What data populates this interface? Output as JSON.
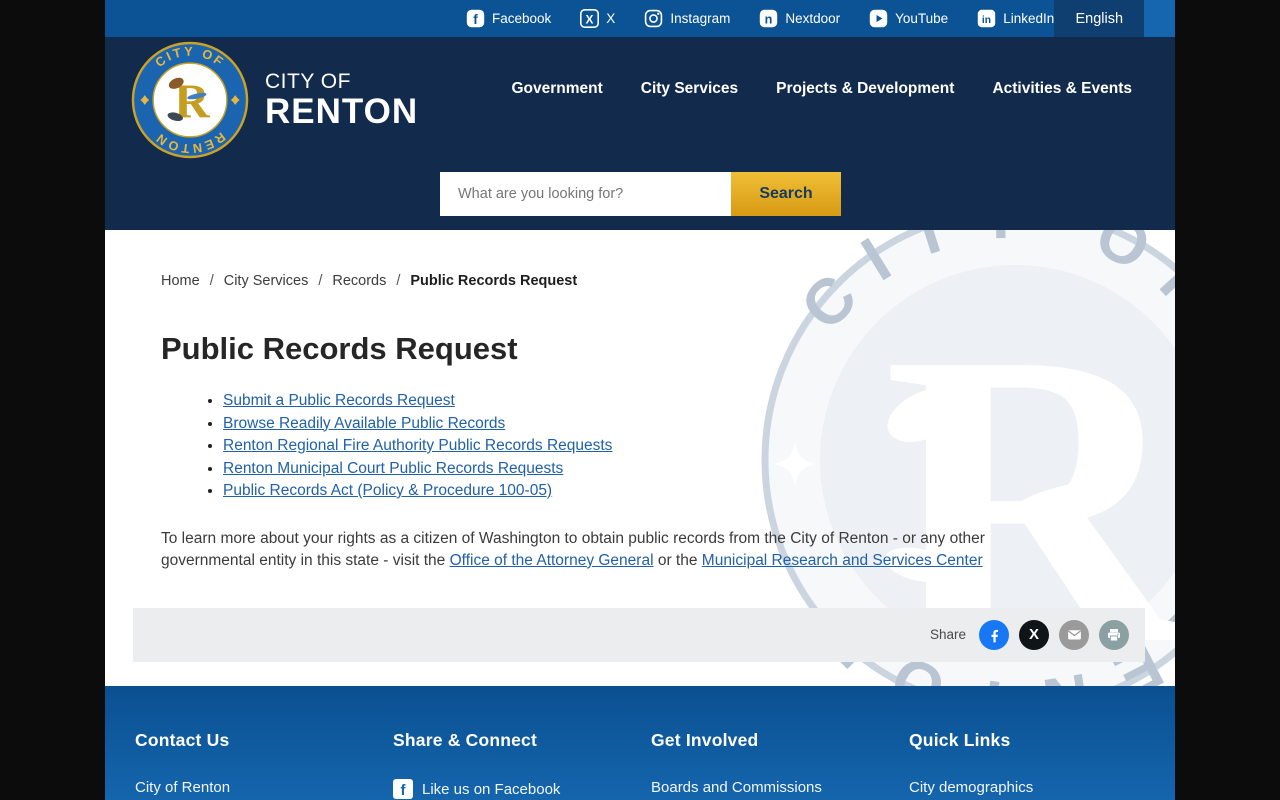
{
  "top_bar": {
    "social_links": [
      {
        "label": "Facebook",
        "icon": "facebook-icon"
      },
      {
        "label": "X",
        "icon": "x-icon"
      },
      {
        "label": "Instagram",
        "icon": "instagram-icon"
      },
      {
        "label": "Nextdoor",
        "icon": "nextdoor-icon"
      },
      {
        "label": "YouTube",
        "icon": "youtube-icon"
      },
      {
        "label": "LinkedIn",
        "icon": "linkedin-icon"
      }
    ],
    "language": "English"
  },
  "header": {
    "logo": {
      "line1": "CITY OF",
      "line2": "RENTON",
      "seal_top": "CITY OF",
      "seal_bottom": "RENTON"
    },
    "nav": [
      {
        "label": "Government"
      },
      {
        "label": "City Services"
      },
      {
        "label": "Projects & Development"
      },
      {
        "label": "Activities & Events"
      }
    ],
    "search": {
      "placeholder": "What are you looking for?",
      "button": "Search"
    }
  },
  "breadcrumb": [
    "Home",
    "City Services",
    "Records",
    "Public Records Request"
  ],
  "page": {
    "title": "Public Records Request",
    "links": [
      "Submit a Public Records Request",
      "Browse Readily Available Public Records",
      "Renton Regional Fire Authority Public Records Requests",
      "Renton Municipal Court Public Records Requests",
      "Public Records Act (Policy & Procedure 100-05)"
    ],
    "paragraph": {
      "before": "To learn more about your rights as a citizen of Washington to obtain public records from the City of Renton - or any other governmental entity in this state - visit the ",
      "link1": "Office of the Attorney General",
      "middle": " or the ",
      "link2": "Municipal Research and Services Center"
    },
    "share_label": "Share"
  },
  "watermark": {
    "top_text": "CITY OF",
    "bottom_text": "RENTON",
    "monogram": "R"
  },
  "icons": {
    "facebook_glyph": "f",
    "x_glyph": "X",
    "nextdoor_glyph": "n",
    "linkedin_glyph": "in"
  },
  "footer": {
    "columns": [
      {
        "heading": "Contact Us",
        "items": [
          "City of Renton"
        ]
      },
      {
        "heading": "Share & Connect",
        "items": [
          "Like us on Facebook"
        ]
      },
      {
        "heading": "Get Involved",
        "items": [
          "Boards and Commissions"
        ]
      },
      {
        "heading": "Quick Links",
        "items": [
          "City demographics"
        ]
      }
    ]
  },
  "colors": {
    "topbar_blue": "#0b5394",
    "header_navy": "#122a4b",
    "gold": "#e2a91f",
    "link_blue": "#2061a8",
    "footer_blue": "#0f5ba0",
    "facebook": "#1877f2",
    "x_black": "#0f1419",
    "share_gray": "#9a9a9a",
    "print_gray": "#8aa0a2",
    "watermark_gray": "#b9c5d3"
  }
}
